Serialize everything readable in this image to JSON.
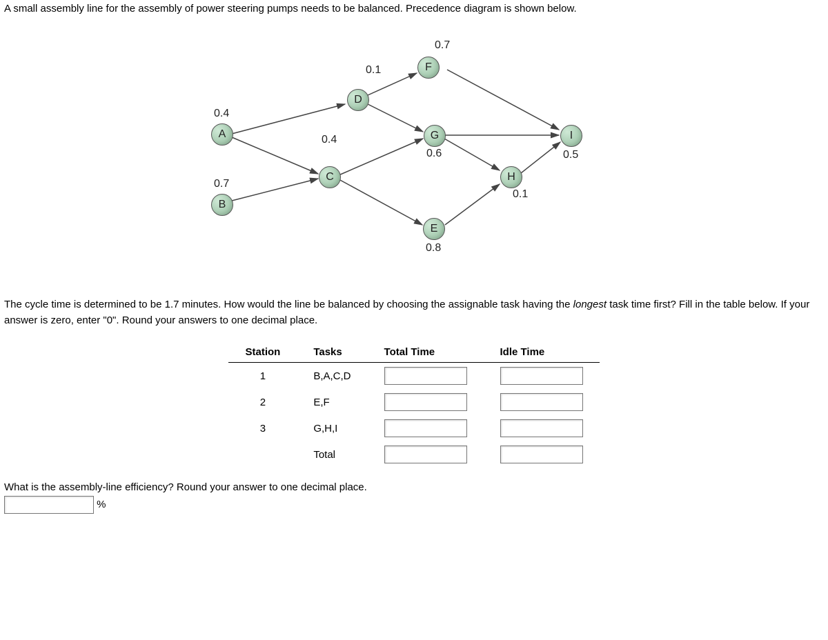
{
  "intro": "A small assembly line for the assembly of power steering pumps needs to be balanced. Precedence diagram is shown below.",
  "nodes": {
    "A": {
      "label": "A",
      "time": "0.4"
    },
    "B": {
      "label": "B",
      "time": "0.7"
    },
    "C": {
      "label": "C",
      "time": "0.4"
    },
    "D": {
      "label": "D",
      "time": "0.1"
    },
    "E": {
      "label": "E",
      "time": "0.8"
    },
    "F": {
      "label": "F",
      "time": "0.7"
    },
    "G": {
      "label": "G",
      "time": "0.6"
    },
    "H": {
      "label": "H",
      "time": "0.1"
    },
    "I": {
      "label": "I",
      "time": "0.5"
    }
  },
  "question_parts": {
    "p1": "The cycle time is determined to be 1.7 minutes. How would the line be balanced by choosing the assignable task having the ",
    "p2": "longest",
    "p3": " task time first? Fill in the table below. If your answer is zero, enter \"0\". Round your answers to one decimal place."
  },
  "table": {
    "headers": {
      "station": "Station",
      "tasks": "Tasks",
      "total": "Total Time",
      "idle": "Idle Time"
    },
    "rows": [
      {
        "station": "1",
        "tasks": "B,A,C,D"
      },
      {
        "station": "2",
        "tasks": "E,F"
      },
      {
        "station": "3",
        "tasks": "G,H,I"
      },
      {
        "station": "",
        "tasks": "Total"
      }
    ]
  },
  "eff_question": "What is the assembly-line efficiency? Round your answer to one decimal place.",
  "percent_label": "%"
}
